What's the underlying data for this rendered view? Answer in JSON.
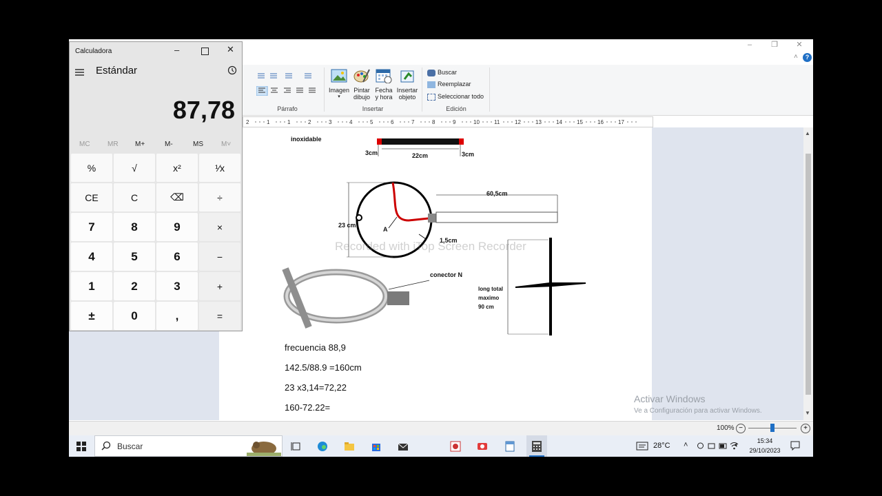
{
  "wordpad": {
    "window_controls": {
      "minimize": "–",
      "restore": "❐",
      "close": "✕"
    },
    "help": "?",
    "ribbon": {
      "paragraph_label": "Párrafo",
      "insert_label": "Insertar",
      "edit_label": "Edición",
      "image": "Imagen",
      "paint_line1": "Pintar",
      "paint_line2": "dibujo",
      "datetime_line1": "Fecha",
      "datetime_line2": "y hora",
      "object_line1": "Insertar",
      "object_line2": "objeto",
      "find": "Buscar",
      "replace": "Reemplazar",
      "select_all": "Seleccionar todo"
    },
    "ruler_numbers": [
      "2",
      "1",
      "1",
      "2",
      "3",
      "4",
      "5",
      "6",
      "7",
      "8",
      "9",
      "10",
      "11",
      "12",
      "13",
      "14",
      "15",
      "16",
      "17"
    ],
    "document": {
      "inoxidable": "inoxidable",
      "dim_3cm_left": "3cm",
      "dim_22cm": "22cm",
      "dim_3cm_right": "3cm",
      "dim_60_5cm": "60,5cm",
      "dim_23cm": "23 cm",
      "point_a": "A",
      "dim_1_5cm": "1,5cm",
      "conector": "conector N",
      "long_total_1": "long total",
      "long_total_2": "maximo",
      "long_total_3": "90 cm",
      "watermark": "Recorded with iTop Screen Recorder",
      "lines": [
        "frecuencia  88,9",
        "142.5/88.9 =160cm",
        "23 x3,14=72,22",
        "160-72.22="
      ]
    },
    "activate_title": "Activar Windows",
    "activate_sub": "Ve a Configuración para activar Windows.",
    "zoom": "100%"
  },
  "calculator": {
    "title": "Calculadora",
    "mode": "Estándar",
    "display": "87,78",
    "memory": [
      "MC",
      "MR",
      "M+",
      "M-",
      "MS",
      "M˅"
    ],
    "keys": [
      [
        "%",
        "√",
        "x²",
        "¹⁄x"
      ],
      [
        "CE",
        "C",
        "⌫",
        "÷"
      ],
      [
        "7",
        "8",
        "9",
        "×"
      ],
      [
        "4",
        "5",
        "6",
        "−"
      ],
      [
        "1",
        "2",
        "3",
        "+"
      ],
      [
        "±",
        "0",
        ",",
        "="
      ]
    ]
  },
  "taskbar": {
    "search_placeholder": "Buscar",
    "temperature": "28°C",
    "time": "15:34",
    "date": "29/10/2023"
  }
}
